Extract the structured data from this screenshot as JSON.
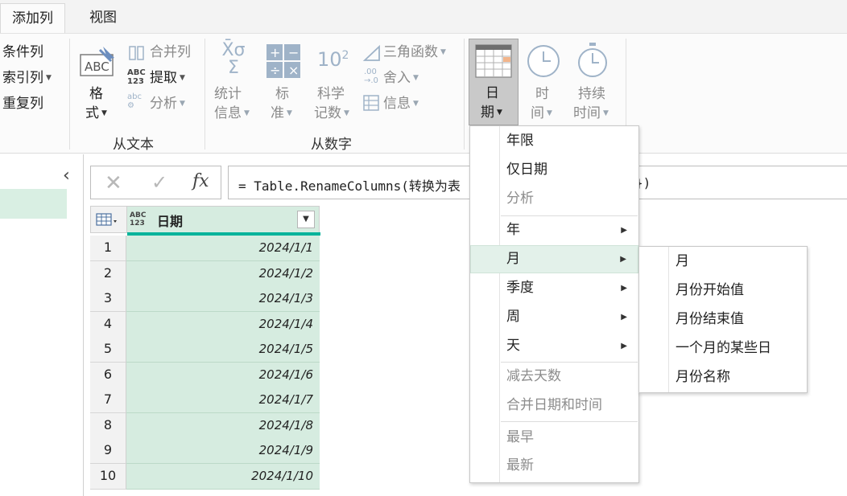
{
  "tabs": [
    {
      "label": "添加列",
      "active": true
    },
    {
      "label": "视图",
      "active": false
    }
  ],
  "ribbon": {
    "general": {
      "conditional": "条件列",
      "index": "索引列",
      "duplicate": "重复列"
    },
    "text_group": {
      "format_line1": "格",
      "format_line2": "式",
      "merge": "合并列",
      "extract": "提取",
      "parse": "分析",
      "label": "从文本"
    },
    "number_group": {
      "stats_line1": "统计",
      "stats_line2": "信息",
      "standard_line1": "标",
      "standard_line2": "准",
      "sci_line1": "科学",
      "sci_line2": "记数",
      "trig": "三角函数",
      "rounding": "舍入",
      "info": "信息",
      "label": "从数字"
    },
    "datetime_group": {
      "date_line1": "日",
      "date_line2": "期",
      "time_line1": "时",
      "time_line2": "间",
      "duration_line1": "持续",
      "duration_line2": "时间"
    }
  },
  "formula": {
    "text_visible": "= Table.RenameColumns(转换为表",
    "tail": "})"
  },
  "table": {
    "type_label": "ABC\n123",
    "column": "日期",
    "rows": [
      {
        "n": "1",
        "v": "2024/1/1"
      },
      {
        "n": "2",
        "v": "2024/1/2"
      },
      {
        "n": "3",
        "v": "2024/1/3"
      },
      {
        "n": "4",
        "v": "2024/1/4"
      },
      {
        "n": "5",
        "v": "2024/1/5"
      },
      {
        "n": "6",
        "v": "2024/1/6"
      },
      {
        "n": "7",
        "v": "2024/1/7"
      },
      {
        "n": "8",
        "v": "2024/1/8"
      },
      {
        "n": "9",
        "v": "2024/1/9"
      },
      {
        "n": "10",
        "v": "2024/1/10"
      }
    ]
  },
  "date_menu": {
    "items": [
      "年限",
      "仅日期",
      "分析",
      "年",
      "月",
      "季度",
      "周",
      "天",
      "减去天数",
      "合并日期和时间",
      "最早",
      "最新"
    ]
  },
  "month_submenu": {
    "items": [
      "月",
      "月份开始值",
      "月份结束值",
      "一个月的某些日",
      "月份名称"
    ]
  },
  "colors": {
    "accent": "#00b39b",
    "selection": "#d6ece0",
    "hover": "#e3f1ea"
  }
}
